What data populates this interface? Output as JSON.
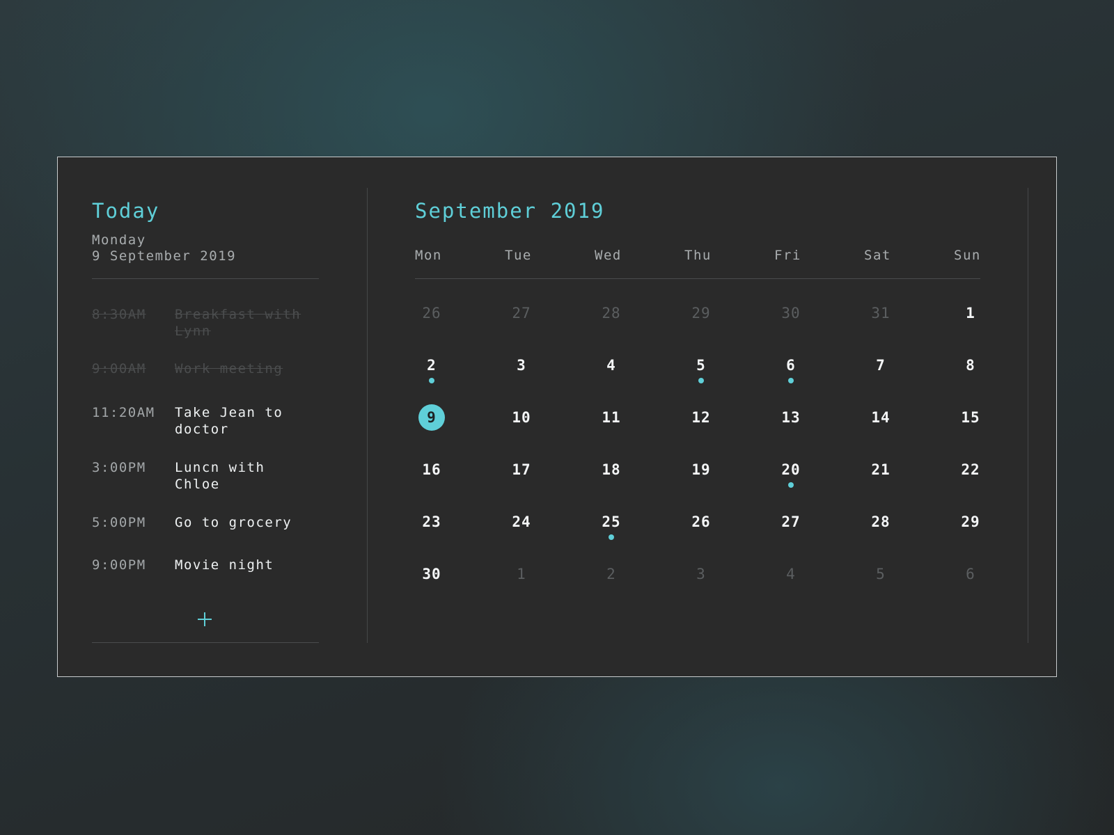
{
  "today_panel": {
    "title": "Today",
    "weekday": "Monday",
    "date": "9 September 2019",
    "events": [
      {
        "time": "8:30AM",
        "title": "Breakfast with Lynn",
        "completed": true
      },
      {
        "time": "9:00AM",
        "title": "Work meeting",
        "completed": true
      },
      {
        "time": "11:20AM",
        "title": "Take Jean to doctor",
        "completed": false
      },
      {
        "time": "3:00PM",
        "title": "Luncn with Chloe",
        "completed": false
      },
      {
        "time": "5:00PM",
        "title": "Go to grocery",
        "completed": false
      },
      {
        "time": "9:00PM",
        "title": "Movie night",
        "completed": false
      }
    ],
    "add_icon": "plus-icon"
  },
  "calendar": {
    "title": "September 2019",
    "weekdays": [
      "Mon",
      "Tue",
      "Wed",
      "Thu",
      "Fri",
      "Sat",
      "Sun"
    ],
    "weeks": [
      [
        {
          "d": "26",
          "out": true
        },
        {
          "d": "27",
          "out": true
        },
        {
          "d": "28",
          "out": true
        },
        {
          "d": "29",
          "out": true
        },
        {
          "d": "30",
          "out": true
        },
        {
          "d": "31",
          "out": true
        },
        {
          "d": "1"
        }
      ],
      [
        {
          "d": "2",
          "dot": true
        },
        {
          "d": "3"
        },
        {
          "d": "4"
        },
        {
          "d": "5",
          "dot": true
        },
        {
          "d": "6",
          "dot": true
        },
        {
          "d": "7"
        },
        {
          "d": "8"
        }
      ],
      [
        {
          "d": "9",
          "today": true
        },
        {
          "d": "10"
        },
        {
          "d": "11"
        },
        {
          "d": "12"
        },
        {
          "d": "13"
        },
        {
          "d": "14"
        },
        {
          "d": "15"
        }
      ],
      [
        {
          "d": "16"
        },
        {
          "d": "17"
        },
        {
          "d": "18"
        },
        {
          "d": "19"
        },
        {
          "d": "20",
          "dot": true
        },
        {
          "d": "21"
        },
        {
          "d": "22"
        }
      ],
      [
        {
          "d": "23"
        },
        {
          "d": "24"
        },
        {
          "d": "25",
          "dot": true
        },
        {
          "d": "26"
        },
        {
          "d": "27"
        },
        {
          "d": "28"
        },
        {
          "d": "29"
        }
      ],
      [
        {
          "d": "30"
        },
        {
          "d": "1",
          "out": true
        },
        {
          "d": "2",
          "out": true
        },
        {
          "d": "3",
          "out": true
        },
        {
          "d": "4",
          "out": true
        },
        {
          "d": "5",
          "out": true
        },
        {
          "d": "6",
          "out": true
        }
      ]
    ]
  },
  "colors": {
    "accent": "#5fcfd8",
    "card_background": "#2a2a2a",
    "text_primary": "#f4f6f7",
    "text_secondary": "#a9adaf",
    "text_muted": "#5b5e60"
  }
}
